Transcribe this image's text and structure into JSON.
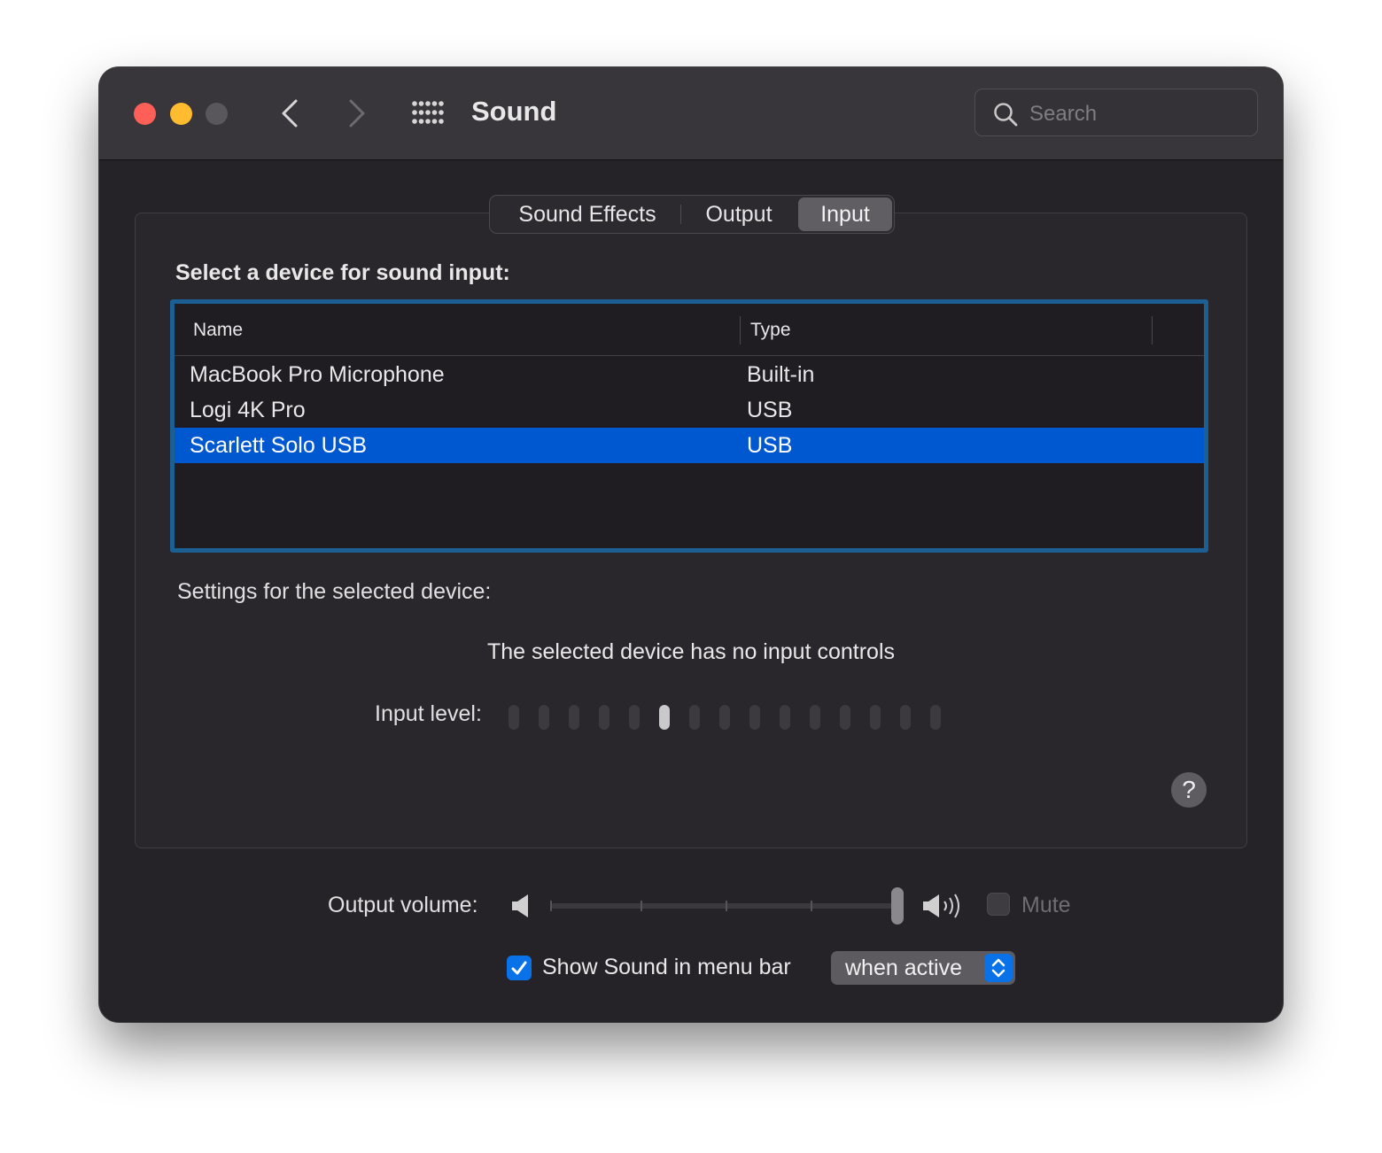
{
  "window": {
    "title": "Sound",
    "search_placeholder": "Search"
  },
  "tabs": [
    {
      "label": "Sound Effects",
      "selected": false
    },
    {
      "label": "Output",
      "selected": false
    },
    {
      "label": "Input",
      "selected": true
    }
  ],
  "input": {
    "section_label": "Select a device for sound input:",
    "columns": {
      "name": "Name",
      "type": "Type"
    },
    "devices": [
      {
        "name": "MacBook Pro Microphone",
        "type": "Built-in",
        "selected": false
      },
      {
        "name": "Logi 4K Pro",
        "type": "USB",
        "selected": false
      },
      {
        "name": "Scarlett Solo USB",
        "type": "USB",
        "selected": true
      }
    ],
    "settings_label": "Settings for the selected device:",
    "no_controls_text": "The selected device has no input controls",
    "level_label": "Input level:",
    "level_segments_total": 15,
    "level_segments_lit_index": 5,
    "help_glyph": "?"
  },
  "footer": {
    "volume_label": "Output volume:",
    "volume_level": 1.0,
    "mute_label": "Mute",
    "mute_checked": false,
    "show_in_menubar_label": "Show Sound in menu bar",
    "show_in_menubar_checked": true,
    "menubar_mode": "when active"
  },
  "colors": {
    "accent": "#0a72e8",
    "selection": "#0058d0",
    "focus_ring": "#1c5f93",
    "close": "#fe5f57",
    "minimize": "#febc2e"
  }
}
